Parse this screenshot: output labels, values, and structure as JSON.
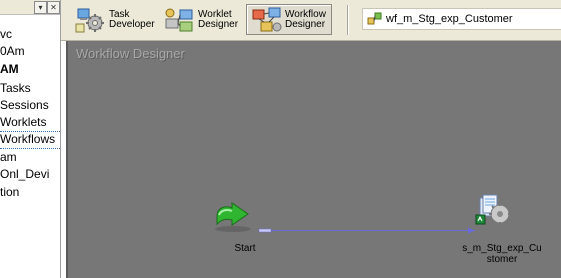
{
  "navigator": {
    "items": [
      {
        "label": "vc",
        "bold": false
      },
      {
        "label": "0Am",
        "bold": false
      },
      {
        "label": "AM",
        "bold": true
      },
      {
        "label": "Tasks",
        "bold": false
      },
      {
        "label": "Sessions",
        "bold": false
      },
      {
        "label": "Worklets",
        "bold": false
      },
      {
        "label": "Workflows",
        "bold": false,
        "selected": true
      },
      {
        "label": "am",
        "bold": false
      },
      {
        "label": "Onl_Devi",
        "bold": false
      },
      {
        "label": "tion",
        "bold": false
      }
    ]
  },
  "toolbar": {
    "task_developer": "Task\nDeveloper",
    "worklet_designer": "Worklet\nDesigner",
    "workflow_designer": "Workflow\nDesigner",
    "active_tool": "workflow_designer",
    "workflow_name": "wf_m_Stg_exp_Customer"
  },
  "canvas": {
    "title": "Workflow Designer",
    "nodes": {
      "start": {
        "label": "Start",
        "icon": "start-arrow-icon"
      },
      "session": {
        "label": "s_m_Stg_exp_Cu\nstomer",
        "icon": "session-task-icon"
      }
    },
    "link": {
      "from": "start",
      "to": "session"
    }
  },
  "colors": {
    "canvas_bg": "#777777",
    "toolbar_bg": "#ece9d8",
    "link_line": "#6a6ad8",
    "start_icon": "#2fb52f"
  }
}
